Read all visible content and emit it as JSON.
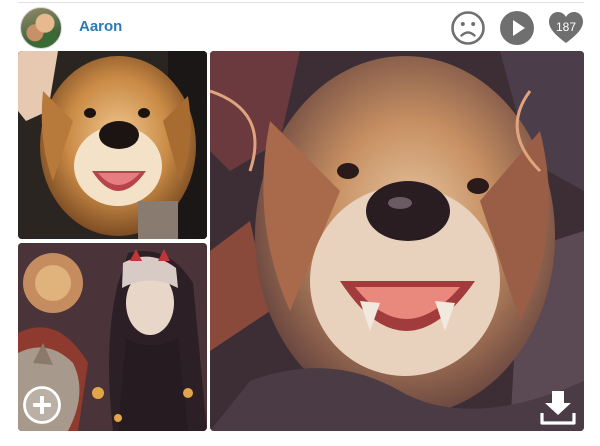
{
  "post": {
    "username": "Aaron",
    "like_count": "187"
  },
  "icons": {
    "avatar": "avatar",
    "sad": "sad-face-icon",
    "play": "play-icon",
    "like": "heart-icon",
    "add": "plus-circle-icon",
    "download": "download-icon"
  },
  "colors": {
    "username": "#2a7ab6",
    "icon_gray": "#6f6f6f"
  }
}
